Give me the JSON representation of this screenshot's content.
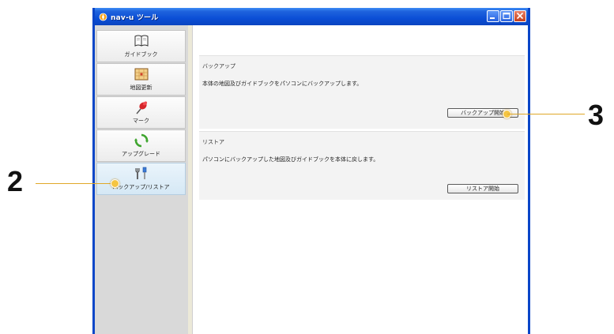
{
  "window": {
    "title": "nav-u ツール"
  },
  "sidebar": {
    "items": [
      {
        "label": "ガイドブック",
        "icon": "book-icon",
        "active": false
      },
      {
        "label": "地図更新",
        "icon": "map-icon",
        "active": false
      },
      {
        "label": "マーク",
        "icon": "pushpin-icon",
        "active": false
      },
      {
        "label": "アップグレード",
        "icon": "refresh-icon",
        "active": false
      },
      {
        "label": "バックアップ/リストア",
        "icon": "tools-icon",
        "active": true
      }
    ]
  },
  "main": {
    "backup": {
      "title": "バックアップ",
      "description": "本体の地図及びガイドブックをパソコンにバックアップします。",
      "button_label": "バックアップ開始"
    },
    "restore": {
      "title": "リストア",
      "description": "パソコンにバックアップした地図及びガイドブックを本体に戻します。",
      "button_label": "リストア開始"
    }
  },
  "callouts": {
    "left": "2",
    "right": "3"
  },
  "colors": {
    "titlebar": "#0b4ed6",
    "callout": "#f5c542"
  }
}
